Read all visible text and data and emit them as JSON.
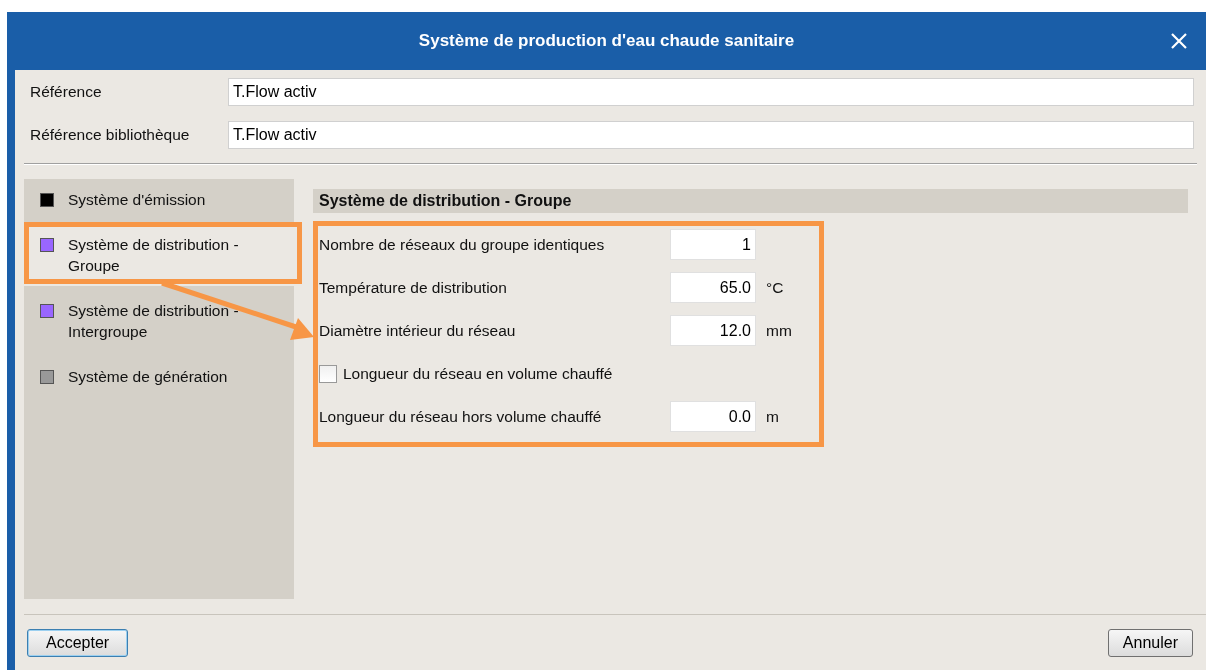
{
  "window": {
    "title": "Système de production d'eau chaude sanitaire"
  },
  "references": [
    {
      "label": "Référence",
      "value": "T.Flow activ"
    },
    {
      "label": "Référence bibliothèque",
      "value": "T.Flow activ"
    }
  ],
  "sidebar": {
    "items": [
      {
        "label": "Système d'émission",
        "color": "#000000",
        "selected": false
      },
      {
        "label": "Système de distribution - Groupe",
        "color": "#9966ff",
        "selected": true
      },
      {
        "label": "Système de distribution - Intergroupe",
        "color": "#9966ff",
        "selected": false
      },
      {
        "label": "Système de génération",
        "color": "#999999",
        "selected": false
      }
    ]
  },
  "panel": {
    "title": "Système de distribution - Groupe",
    "rows": [
      {
        "kind": "field",
        "label": "Nombre de réseaux du groupe identiques",
        "value": "1"
      },
      {
        "kind": "field",
        "label": "Température de distribution",
        "value": "65.0",
        "unit": "°C"
      },
      {
        "kind": "field",
        "label": "Diamètre intérieur du réseau",
        "value": "12.0",
        "unit": "mm"
      },
      {
        "kind": "checkbox",
        "label": "Longueur du réseau en volume chauffé",
        "checked": false
      },
      {
        "kind": "field",
        "label": "Longueur du réseau hors volume chauffé",
        "value": "0.0",
        "unit": "m"
      }
    ]
  },
  "buttons": {
    "accept": "Accepter",
    "cancel": "Annuler"
  }
}
